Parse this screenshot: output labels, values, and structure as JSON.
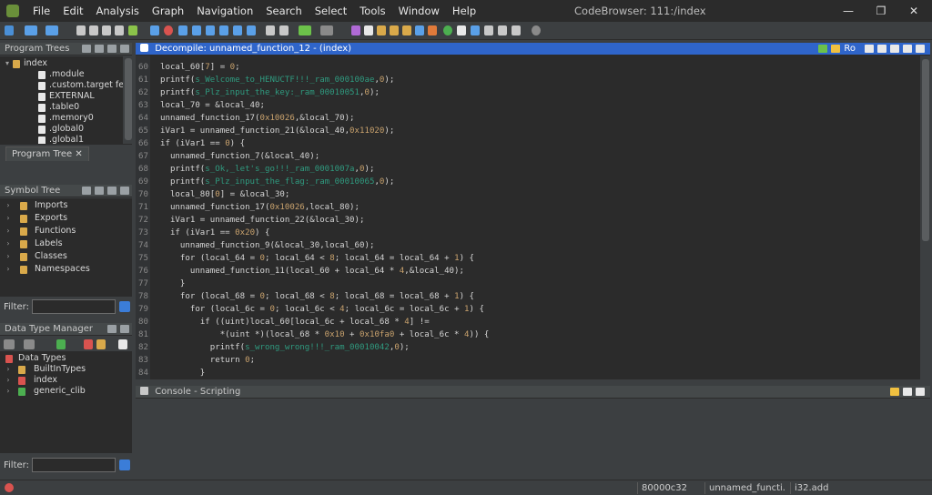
{
  "window": {
    "title": "CodeBrowser: 111:/index",
    "menu": [
      "File",
      "Edit",
      "Analysis",
      "Graph",
      "Navigation",
      "Search",
      "Select",
      "Tools",
      "Window",
      "Help"
    ],
    "minimize": "—",
    "maximize": "❐",
    "close": "✕"
  },
  "program_trees": {
    "title": "Program Trees",
    "root": "index",
    "items": [
      ".module",
      ".custom.target fe",
      "EXTERNAL",
      ".table0",
      ".memory0",
      ".global0",
      ".global1"
    ],
    "tab_label": "Program Tree",
    "tab_close": "✕"
  },
  "symbol_tree": {
    "title": "Symbol Tree",
    "items": [
      "Imports",
      "Exports",
      "Functions",
      "Labels",
      "Classes",
      "Namespaces"
    ],
    "filter_label": "Filter:"
  },
  "data_type_manager": {
    "title": "Data Type Manager",
    "root": "Data Types",
    "items": [
      "BuiltInTypes",
      "index",
      "generic_clib"
    ],
    "filter_label": "Filter:"
  },
  "decompile": {
    "title": "Decompile: unnamed_function_12 -  (index)",
    "ro_label": "Ro",
    "lines": [
      {
        "n": "60",
        "code": "local_60[7] = 0;"
      },
      {
        "n": "61",
        "code": "printf(s_Welcome_to_HENUCTF!!!_ram_000100ae,0);"
      },
      {
        "n": "62",
        "code": "printf(s_Plz_input_the_key:_ram_00010051,0);"
      },
      {
        "n": "63",
        "code": "local_70 = &local_40;"
      },
      {
        "n": "64",
        "code": "unnamed_function_17(0x10026,&local_70);"
      },
      {
        "n": "65",
        "code": "iVar1 = unnamed_function_21(&local_40,0x11020);"
      },
      {
        "n": "66",
        "code": "if (iVar1 == 0) {"
      },
      {
        "n": "67",
        "code": "  unnamed_function_7(&local_40);"
      },
      {
        "n": "68",
        "code": "  printf(s_Ok,_let's_go!!!_ram_0001007a,0);"
      },
      {
        "n": "69",
        "code": "  printf(s_Plz_input_the_flag:_ram_00010065,0);"
      },
      {
        "n": "70",
        "code": "  local_80[0] = &local_30;"
      },
      {
        "n": "71",
        "code": "  unnamed_function_17(0x10026,local_80);"
      },
      {
        "n": "72",
        "code": "  iVar1 = unnamed_function_22(&local_30);"
      },
      {
        "n": "73",
        "code": "  if (iVar1 == 0x20) {"
      },
      {
        "n": "74",
        "code": "    unnamed_function_9(&local_30,local_60);"
      },
      {
        "n": "75",
        "code": "    for (local_64 = 0; local_64 < 8; local_64 = local_64 + 1) {"
      },
      {
        "n": "76",
        "code": "      unnamed_function_11(local_60 + local_64 * 4,&local_40);"
      },
      {
        "n": "77",
        "code": "    }"
      },
      {
        "n": "78",
        "code": "    for (local_68 = 0; local_68 < 8; local_68 = local_68 + 1) {"
      },
      {
        "n": "79",
        "code": "      for (local_6c = 0; local_6c < 4; local_6c = local_6c + 1) {"
      },
      {
        "n": "80",
        "code": "        if ((uint)local_60[local_6c + local_68 * 4] !="
      },
      {
        "n": "81",
        "code": "            *(uint *)(local_68 * 0x10 + 0x10fa0 + local_6c * 4)) {"
      },
      {
        "n": "82",
        "code": "          printf(s_wrong_wrong!!!_ram_00010042,0);"
      },
      {
        "n": "83",
        "code": "          return 0;"
      },
      {
        "n": "84",
        "code": "        }"
      }
    ]
  },
  "console": {
    "title": "Console - Scripting"
  },
  "status": {
    "address": "80000c32",
    "function": "unnamed_functi...",
    "type": "i32.add"
  },
  "colors": {
    "accent": "#2f65ca",
    "string": "#2f9a7f",
    "number": "#c9a26d",
    "keyword": "#cc7832"
  }
}
